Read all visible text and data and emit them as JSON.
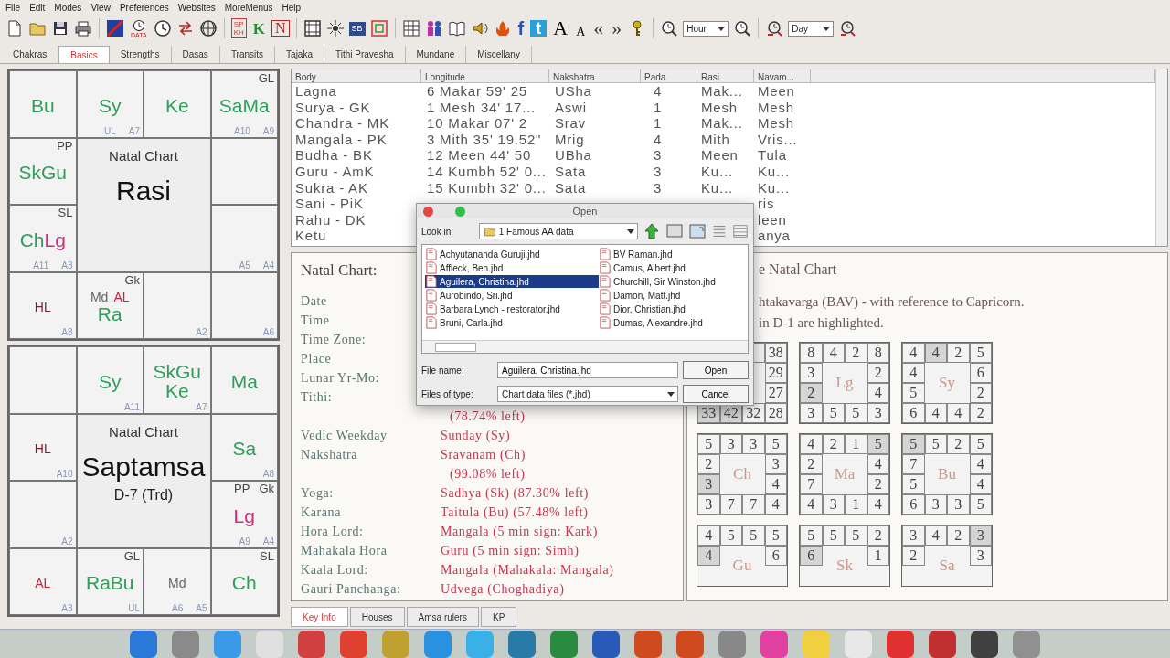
{
  "menu": [
    "File",
    "Edit",
    "Modes",
    "View",
    "Preferences",
    "Websites",
    "MoreMenus",
    "Help"
  ],
  "toolbar": {
    "texts": [
      "DATA",
      "SP",
      "KH",
      "K",
      "N",
      "SB",
      "f",
      "t",
      "A",
      "A",
      "«",
      "»"
    ],
    "hour": "Hour",
    "day": "Day"
  },
  "tabs": [
    {
      "label": "Chakras",
      "selected": false
    },
    {
      "label": "Basics",
      "selected": true
    },
    {
      "label": "Strengths",
      "selected": false
    },
    {
      "label": "Dasas",
      "selected": false
    },
    {
      "label": "Transits",
      "selected": false
    },
    {
      "label": "Tajaka",
      "selected": false
    },
    {
      "label": "Tithi Pravesha",
      "selected": false
    },
    {
      "label": "Mundane",
      "selected": false
    },
    {
      "label": "Miscellany",
      "selected": false
    }
  ],
  "charts": [
    {
      "caption": "Natal Chart",
      "title": "Rasi",
      "cells": [
        {
          "items": [
            {
              "kind": "planet",
              "text": "Bu",
              "color": "#2f9e5a"
            }
          ]
        },
        {
          "items": [
            {
              "kind": "planet",
              "text": "Sy",
              "color": "#2f9e5a"
            },
            {
              "kind": "arudha",
              "text": "UL"
            },
            {
              "kind": "arudha",
              "text": "A7"
            }
          ]
        },
        {
          "items": [
            {
              "kind": "planet",
              "text": "Ke",
              "color": "#2f9e5a"
            }
          ]
        },
        {
          "items": [
            {
              "kind": "tag",
              "text": "GL",
              "color": "#444444"
            },
            {
              "kind": "planet",
              "text": "Sa",
              "color": "#2f9e5a"
            },
            {
              "kind": "planet",
              "text": "Ma",
              "color": "#2f9e5a"
            },
            {
              "kind": "arudha",
              "text": "A10"
            },
            {
              "kind": "arudha",
              "text": "A9"
            }
          ]
        },
        {
          "items": [
            {
              "kind": "tag",
              "text": "PP",
              "color": "#444444"
            },
            {
              "kind": "planet",
              "text": "Sk",
              "color": "#2f9e5a"
            },
            {
              "kind": "planet",
              "text": "Gu",
              "color": "#2f9e5a"
            }
          ]
        },
        {},
        {
          "items": [
            {
              "kind": "tag",
              "text": "SL",
              "color": "#444444"
            },
            {
              "kind": "planet",
              "text": "Ch",
              "color": "#2f9e5a"
            },
            {
              "kind": "planet",
              "text": "Lg",
              "color": "#d02d7c"
            },
            {
              "kind": "arudha",
              "text": "A11"
            },
            {
              "kind": "arudha",
              "text": "A3"
            }
          ]
        },
        {
          "items": [
            {
              "kind": "arudha",
              "text": "A5"
            },
            {
              "kind": "arudha",
              "text": "A4"
            }
          ]
        },
        {
          "items": [
            {
              "kind": "note",
              "text": "HL",
              "color": "#7a1a2a"
            },
            {
              "kind": "arudha",
              "text": "A8"
            }
          ]
        },
        {
          "items": [
            {
              "kind": "tag",
              "text": "Gk",
              "color": "#444444"
            },
            {
              "kind": "note",
              "text": "Md",
              "color": "#666666"
            },
            {
              "kind": "note",
              "text": "AL",
              "color": "#d0203a"
            },
            {
              "kind": "planet",
              "text": "Ra",
              "color": "#2f9e5a"
            }
          ]
        },
        {
          "items": [
            {
              "kind": "arudha",
              "text": "A2"
            }
          ]
        },
        {
          "items": [
            {
              "kind": "arudha",
              "text": "A6"
            }
          ]
        }
      ]
    },
    {
      "caption": "Natal Chart",
      "title": "Saptamsa",
      "subtitle": "D-7 (Trd)",
      "cells": [
        {},
        {
          "items": [
            {
              "kind": "planet",
              "text": "Sy",
              "color": "#2f9e5a"
            },
            {
              "kind": "arudha",
              "text": "A11"
            }
          ]
        },
        {
          "items": [
            {
              "kind": "planet",
              "text": "Sk",
              "color": "#2f9e5a"
            },
            {
              "kind": "planet",
              "text": "Gu",
              "color": "#2f9e5a"
            },
            {
              "kind": "planet",
              "text": "Ke",
              "color": "#2f9e5a"
            },
            {
              "kind": "arudha",
              "text": "A7"
            }
          ]
        },
        {
          "items": [
            {
              "kind": "planet",
              "text": "Ma",
              "color": "#2f9e5a"
            }
          ]
        },
        {
          "items": [
            {
              "kind": "note",
              "text": "HL",
              "color": "#7a1a2a"
            },
            {
              "kind": "arudha",
              "text": "A10"
            }
          ]
        },
        {
          "items": [
            {
              "kind": "planet",
              "text": "Sa",
              "color": "#2f9e5a"
            },
            {
              "kind": "arudha",
              "text": "A8"
            }
          ]
        },
        {
          "items": [
            {
              "kind": "arudha",
              "text": "A2"
            }
          ]
        },
        {
          "items": [
            {
              "kind": "tag",
              "text": "PP",
              "color": "#444444"
            },
            {
              "kind": "tag",
              "text": "Gk",
              "color": "#444444"
            },
            {
              "kind": "planet",
              "text": "Lg",
              "color": "#d02d7c"
            },
            {
              "kind": "arudha",
              "text": "A9"
            },
            {
              "kind": "arudha",
              "text": "A4"
            }
          ]
        },
        {
          "items": [
            {
              "kind": "note",
              "text": "AL",
              "color": "#d0203a"
            },
            {
              "kind": "arudha",
              "text": "A3"
            }
          ]
        },
        {
          "items": [
            {
              "kind": "tag",
              "text": "GL",
              "color": "#444444"
            },
            {
              "kind": "planet",
              "text": "Ra",
              "color": "#2f9e5a"
            },
            {
              "kind": "planet",
              "text": "Bu",
              "color": "#2f9e5a"
            },
            {
              "kind": "arudha",
              "text": "UL"
            }
          ]
        },
        {
          "items": [
            {
              "kind": "note",
              "text": "Md",
              "color": "#666666"
            },
            {
              "kind": "arudha",
              "text": "A6"
            },
            {
              "kind": "arudha",
              "text": "A5"
            }
          ]
        },
        {
          "items": [
            {
              "kind": "tag",
              "text": "SL",
              "color": "#444444"
            },
            {
              "kind": "planet",
              "text": "Ch",
              "color": "#2f9e5a"
            }
          ]
        }
      ]
    }
  ],
  "table": {
    "columns": [
      "Body",
      "Longitude",
      "Nakshatra",
      "Pada",
      "Rasi",
      "Navam..."
    ],
    "rows": [
      [
        "Lagna",
        "6 Makar 59' 25",
        "USha",
        "4",
        "Mak...",
        "Meen"
      ],
      [
        "Surya - GK",
        "1 Mesh 34' 17...",
        "Aswi",
        "1",
        "Mesh",
        "Mesh"
      ],
      [
        "Chandra - MK",
        "10 Makar 07' 2",
        "Srav",
        "1",
        "Mak...",
        "Mesh"
      ],
      [
        "Mangala - PK",
        "3 Mith 35' 19.52\"",
        "Mrig",
        "4",
        "Mith",
        "Vris..."
      ],
      [
        "Budha - BK",
        "12 Meen 44' 50",
        "UBha",
        "3",
        "Meen",
        "Tula"
      ],
      [
        "Guru - AmK",
        "14 Kumbh 52' 0...",
        "Sata",
        "3",
        "Ku...",
        "Ku..."
      ],
      [
        "Sukra - AK",
        "15 Kumbh 32' 0...",
        "Sata",
        "3",
        "Ku...",
        "Ku..."
      ],
      [
        "Sani - PiK",
        null,
        null,
        null,
        null,
        "ris"
      ],
      [
        "Rahu - DK",
        null,
        null,
        null,
        null,
        "leen"
      ],
      [
        "Ketu",
        null,
        null,
        null,
        null,
        "anya"
      ]
    ]
  },
  "key_info": {
    "heading": "Natal Chart:",
    "rows": [
      {
        "label": "Date"
      },
      {
        "label": "Time"
      },
      {
        "label": "Time Zone:"
      },
      {
        "label": "Place"
      },
      {
        "label": "Lunar Yr-Mo:"
      },
      {
        "label": "Tithi:"
      },
      {
        "value": "(78.74% left)"
      },
      {
        "label": "Vedic Weekday",
        "value": "Sunday (Sy)"
      },
      {
        "label": "Nakshatra",
        "value": "Sravanam (Ch)"
      },
      {
        "value": "(99.08% left)"
      },
      {
        "label": "Yoga:",
        "value": "Sadhya (Sk) (87.30% left)"
      },
      {
        "label": "Karana",
        "value": "Taitula (Bu) (57.48% left)"
      },
      {
        "label": "Hora Lord:",
        "value": "Mangala (5 min sign: Kark)"
      },
      {
        "label": "Mahakala Hora",
        "value": "Guru (5 min sign: Simh)"
      },
      {
        "label": "Kaala Lord:",
        "value": "Mangala (Mahakala: Mangala)"
      },
      {
        "label": "Gauri Panchanga:",
        "value": "Udvega (Choghadiya)"
      }
    ]
  },
  "bav": {
    "lines": [
      "e Natal Chart",
      "htakavarga (BAV) - with reference to Capricorn.",
      "in D-1 are highlighted."
    ],
    "boxes": [
      {
        "cells": [
          null,
          null,
          null,
          {
            "text": "38",
            "highlighted": false
          },
          null,
          {
            "text": "29",
            "highlighted": false
          },
          null,
          {
            "text": "27",
            "highlighted": false
          },
          {
            "text": "33",
            "highlighted": true
          },
          {
            "text": "42",
            "highlighted": true
          },
          {
            "text": "32",
            "highlighted": false
          },
          {
            "text": "28",
            "highlighted": false
          }
        ]
      },
      {
        "label": "Lg",
        "cells": [
          {
            "text": "8",
            "highlighted": false
          },
          {
            "text": "4",
            "highlighted": false
          },
          {
            "text": "2",
            "highlighted": false
          },
          {
            "text": "8",
            "highlighted": false
          },
          {
            "text": "3",
            "highlighted": false
          },
          {
            "text": "2",
            "highlighted": false
          },
          {
            "text": "2",
            "highlighted": true
          },
          {
            "text": "4",
            "highlighted": false
          },
          {
            "text": "3",
            "highlighted": false
          },
          {
            "text": "5",
            "highlighted": false
          },
          {
            "text": "5",
            "highlighted": false
          },
          {
            "text": "3",
            "highlighted": false
          }
        ]
      },
      {
        "label": "Sy",
        "cells": [
          {
            "text": "4",
            "highlighted": false
          },
          {
            "text": "4",
            "highlighted": true
          },
          {
            "text": "2",
            "highlighted": false
          },
          {
            "text": "5",
            "highlighted": false
          },
          {
            "text": "4",
            "highlighted": false
          },
          {
            "text": "6",
            "highlighted": false
          },
          {
            "text": "5",
            "highlighted": false
          },
          {
            "text": "2",
            "highlighted": false
          },
          {
            "text": "6",
            "highlighted": false
          },
          {
            "text": "4",
            "highlighted": false
          },
          {
            "text": "4",
            "highlighted": false
          },
          {
            "text": "2",
            "highlighted": false
          }
        ]
      },
      {
        "label": "Ch",
        "cells": [
          {
            "text": "5",
            "highlighted": false
          },
          {
            "text": "3",
            "highlighted": false
          },
          {
            "text": "3",
            "highlighted": false
          },
          {
            "text": "5",
            "highlighted": false
          },
          {
            "text": "2",
            "highlighted": false
          },
          {
            "text": "3",
            "highlighted": false
          },
          {
            "text": "3",
            "highlighted": true
          },
          {
            "text": "4",
            "highlighted": false
          },
          {
            "text": "3",
            "highlighted": false
          },
          {
            "text": "7",
            "highlighted": false
          },
          {
            "text": "7",
            "highlighted": false
          },
          {
            "text": "4",
            "highlighted": false
          }
        ]
      },
      {
        "label": "Ma",
        "cells": [
          {
            "text": "4",
            "highlighted": false
          },
          {
            "text": "2",
            "highlighted": false
          },
          {
            "text": "1",
            "highlighted": false
          },
          {
            "text": "5",
            "highlighted": true
          },
          {
            "text": "2",
            "highlighted": false
          },
          {
            "text": "4",
            "highlighted": false
          },
          {
            "text": "7",
            "highlighted": false
          },
          {
            "text": "2",
            "highlighted": false
          },
          {
            "text": "4",
            "highlighted": false
          },
          {
            "text": "3",
            "highlighted": false
          },
          {
            "text": "1",
            "highlighted": false
          },
          {
            "text": "4",
            "highlighted": false
          }
        ]
      },
      {
        "label": "Bu",
        "cells": [
          {
            "text": "5",
            "highlighted": true
          },
          {
            "text": "5",
            "highlighted": false
          },
          {
            "text": "2",
            "highlighted": false
          },
          {
            "text": "5",
            "highlighted": false
          },
          {
            "text": "7",
            "highlighted": false
          },
          {
            "text": "4",
            "highlighted": false
          },
          {
            "text": "5",
            "highlighted": false
          },
          {
            "text": "4",
            "highlighted": false
          },
          {
            "text": "6",
            "highlighted": false
          },
          {
            "text": "3",
            "highlighted": false
          },
          {
            "text": "3",
            "highlighted": false
          },
          {
            "text": "5",
            "highlighted": false
          }
        ]
      },
      {
        "label": "Gu",
        "cells": [
          {
            "text": "4",
            "highlighted": false
          },
          {
            "text": "5",
            "highlighted": false
          },
          {
            "text": "5",
            "highlighted": false
          },
          {
            "text": "5",
            "highlighted": false
          },
          {
            "text": "4",
            "highlighted": true
          },
          {
            "text": "6",
            "highlighted": false
          }
        ]
      },
      {
        "label": "Sk",
        "cells": [
          {
            "text": "5",
            "highlighted": false
          },
          {
            "text": "5",
            "highlighted": false
          },
          {
            "text": "5",
            "highlighted": false
          },
          {
            "text": "2",
            "highlighted": false
          },
          {
            "text": "6",
            "highlighted": true
          },
          {
            "text": "1",
            "highlighted": false
          }
        ]
      },
      {
        "label": "Sa",
        "cells": [
          {
            "text": "3",
            "highlighted": false
          },
          {
            "text": "4",
            "highlighted": false
          },
          {
            "text": "2",
            "highlighted": false
          },
          {
            "text": "3",
            "highlighted": true
          },
          {
            "text": "2",
            "highlighted": false
          },
          {
            "text": "3",
            "highlighted": false
          }
        ]
      }
    ]
  },
  "bottom_tabs": [
    {
      "label": "Key Info",
      "selected": true
    },
    {
      "label": "Houses",
      "selected": false
    },
    {
      "label": "Amsa rulers",
      "selected": false
    },
    {
      "label": "KP",
      "selected": false
    }
  ],
  "dialog": {
    "title": "Open",
    "look_in_label": "Look in:",
    "look_in": "1 Famous AA data",
    "files": [
      {
        "name": "Achyutananda Guruji.jhd",
        "selected": false
      },
      {
        "name": "Affleck, Ben.jhd",
        "selected": false
      },
      {
        "name": "Aguilera, Christina.jhd",
        "selected": true
      },
      {
        "name": "Aurobindo, Sri.jhd",
        "selected": false
      },
      {
        "name": "Barbara Lynch - restorator.jhd",
        "selected": false
      },
      {
        "name": "Bruni, Carla.jhd",
        "selected": false
      },
      {
        "name": "BV Raman.jhd",
        "selected": false
      },
      {
        "name": "Camus, Albert.jhd",
        "selected": false
      },
      {
        "name": "Churchill, Sir Winston.jhd",
        "selected": false
      },
      {
        "name": "Damon, Matt.jhd",
        "selected": false
      },
      {
        "name": "Dior, Christian.jhd",
        "selected": false
      },
      {
        "name": "Dumas, Alexandre.jhd",
        "selected": false
      }
    ],
    "file_name_label": "File name:",
    "file_name": "Aguilera, Christina.jhd",
    "type_label": "Files of type:",
    "type": "Chart data files (*.jhd)",
    "buttons": [
      "Open",
      "Cancel"
    ]
  }
}
